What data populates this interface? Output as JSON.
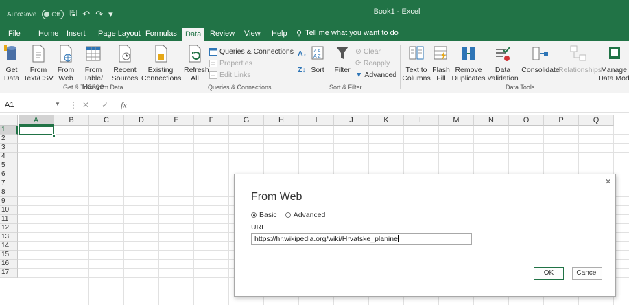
{
  "titlebar": {
    "autosave_label": "AutoSave",
    "autosave_state": "Off",
    "doc_title": "Book1  -  Excel",
    "bg": "#217346"
  },
  "menu": {
    "tabs": [
      "File",
      "Home",
      "Insert",
      "Page Layout",
      "Formulas",
      "Data",
      "Review",
      "View",
      "Help"
    ],
    "active_tab": "Data",
    "tellme": "Tell me what you want to do"
  },
  "ribbon": {
    "get_data": "Get Data",
    "from_text_csv": "From Text/CSV",
    "from_web": "From Web",
    "from_table_range": "From Table/ Range",
    "recent_sources": "Recent Sources",
    "existing_connections": "Existing Connections",
    "group_get_transform": "Get & Transform Data",
    "refresh_all": "Refresh All",
    "queries_connections": "Queries & Connections",
    "properties": "Properties",
    "edit_links": "Edit Links",
    "group_queries": "Queries & Connections",
    "sort": "Sort",
    "filter": "Filter",
    "clear": "Clear",
    "reapply": "Reapply",
    "advanced": "Advanced",
    "group_sort_filter": "Sort & Filter",
    "text_to_columns": "Text to Columns",
    "flash_fill": "Flash Fill",
    "remove_duplicates": "Remove Duplicates",
    "data_validation": "Data Validation",
    "consolidate": "Consolidate",
    "relationships": "Relationships",
    "manage_data_model": "Manage Data Mod",
    "group_data_tools": "Data Tools"
  },
  "formula_bar": {
    "name_box": "A1",
    "fx": "fx",
    "value": ""
  },
  "sheet": {
    "columns": [
      "A",
      "B",
      "C",
      "D",
      "E",
      "F",
      "G",
      "H",
      "I",
      "J",
      "K",
      "L",
      "M",
      "N",
      "O",
      "P",
      "Q"
    ],
    "rows": [
      "1",
      "2",
      "3",
      "4",
      "5",
      "6",
      "7",
      "8",
      "9",
      "10",
      "11",
      "12",
      "13",
      "14",
      "15",
      "16",
      "17"
    ],
    "active_cell": "A1"
  },
  "dialog": {
    "title": "From Web",
    "mode_basic": "Basic",
    "mode_advanced": "Advanced",
    "selected_mode": "Basic",
    "url_label": "URL",
    "url_value": "https://hr.wikipedia.org/wiki/Hrvatske_planine",
    "ok": "OK",
    "cancel": "Cancel",
    "close": "×"
  }
}
